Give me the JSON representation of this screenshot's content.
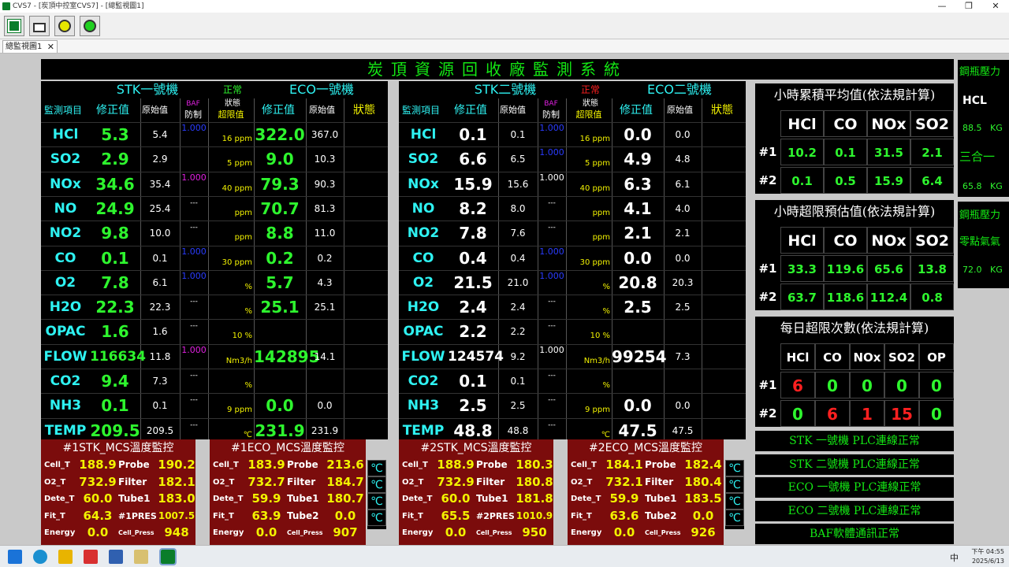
{
  "window": {
    "title": "CVS7 - [炭頂中控室CVS7] - [總監視圖1]",
    "min": "—",
    "max": "❐",
    "close": "✕"
  },
  "tab": {
    "label": "總監視圖1",
    "close": "✕"
  },
  "banner": "炭頂資源回收廠監測系統",
  "left": {
    "stk_title": "STK一號機",
    "stk_state": "正常",
    "eco_title": "ECO一號機",
    "headers": {
      "item": "監測項目",
      "corr": "修正值",
      "raw": "原始值",
      "baf_top": "BAF",
      "baf_bot": "防制",
      "state_top": "狀態",
      "state_bot": "超限值",
      "eco_corr": "修正值",
      "eco_raw": "原始值",
      "eco_state": "狀態"
    },
    "rows": [
      {
        "name": "HCl",
        "v": "5.3",
        "raw": "5.4",
        "baf": "1.000",
        "lim": "16 ppm",
        "ev": "322.0",
        "er": "367.0"
      },
      {
        "name": "SO2",
        "v": "2.9",
        "raw": "2.9",
        "baf": "",
        "lim": "5 ppm",
        "ev": "9.0",
        "er": "10.3"
      },
      {
        "name": "NOx",
        "v": "34.6",
        "raw": "35.4",
        "baf": "1.000",
        "lim": "40 ppm",
        "ev": "79.3",
        "er": "90.3"
      },
      {
        "name": "NO",
        "v": "24.9",
        "raw": "25.4",
        "baf": "---",
        "lim": "ppm",
        "ev": "70.7",
        "er": "81.3"
      },
      {
        "name": "NO2",
        "v": "9.8",
        "raw": "10.0",
        "baf": "---",
        "lim": "ppm",
        "ev": "8.8",
        "er": "11.0"
      },
      {
        "name": "CO",
        "v": "0.1",
        "raw": "0.1",
        "baf": "1.000",
        "lim": "30 ppm",
        "ev": "0.2",
        "er": "0.2"
      },
      {
        "name": "O2",
        "v": "7.8",
        "raw": "6.1",
        "baf": "1.000",
        "lim": "%",
        "ev": "5.7",
        "er": "4.3"
      },
      {
        "name": "H2O",
        "v": "22.3",
        "raw": "22.3",
        "baf": "---",
        "lim": "%",
        "ev": "25.1",
        "er": "25.1"
      },
      {
        "name": "OPAC",
        "v": "1.6",
        "raw": "1.6",
        "baf": "---",
        "lim": "10 %",
        "ev": "",
        "er": ""
      },
      {
        "name": "FLOW",
        "v": "116634",
        "raw": "11.8",
        "baf": "1.000",
        "lim": "Nm3/h",
        "ev": "142895",
        "er": "14.1"
      },
      {
        "name": "CO2",
        "v": "9.4",
        "raw": "7.3",
        "baf": "---",
        "lim": "%",
        "ev": "",
        "er": ""
      },
      {
        "name": "NH3",
        "v": "0.1",
        "raw": "0.1",
        "baf": "---",
        "lim": "9 ppm",
        "ev": "0.0",
        "er": "0.0"
      },
      {
        "name": "TEMP",
        "v": "209.5",
        "raw": "209.5",
        "baf": "---",
        "lim": "℃",
        "ev": "231.9",
        "er": "231.9"
      }
    ]
  },
  "right": {
    "stk_title": "STK二號機",
    "stk_state": "正常",
    "eco_title": "ECO二號機",
    "headers": {
      "item": "監測項目",
      "corr": "修正值",
      "raw": "原始值",
      "baf_top": "BAF",
      "baf_bot": "防制",
      "state_top": "狀態",
      "state_bot": "超限值",
      "eco_corr": "修正值",
      "eco_raw": "原始值",
      "eco_state": "狀態"
    },
    "rows": [
      {
        "name": "HCl",
        "v": "0.1",
        "raw": "0.1",
        "baf": "1.000",
        "lim": "16 ppm",
        "ev": "0.0",
        "er": "0.0"
      },
      {
        "name": "SO2",
        "v": "6.6",
        "raw": "6.5",
        "baf": "1.000",
        "lim": "5 ppm",
        "ev": "4.9",
        "er": "4.8"
      },
      {
        "name": "NOx",
        "v": "15.9",
        "raw": "15.6",
        "baf": "1.000",
        "lim": "40 ppm",
        "ev": "6.3",
        "er": "6.1"
      },
      {
        "name": "NO",
        "v": "8.2",
        "raw": "8.0",
        "baf": "---",
        "lim": "ppm",
        "ev": "4.1",
        "er": "4.0"
      },
      {
        "name": "NO2",
        "v": "7.8",
        "raw": "7.6",
        "baf": "---",
        "lim": "ppm",
        "ev": "2.1",
        "er": "2.1"
      },
      {
        "name": "CO",
        "v": "0.4",
        "raw": "0.4",
        "baf": "1.000",
        "lim": "30 ppm",
        "ev": "0.0",
        "er": "0.0"
      },
      {
        "name": "O2",
        "v": "21.5",
        "raw": "21.0",
        "baf": "1.000",
        "lim": "%",
        "ev": "20.8",
        "er": "20.3"
      },
      {
        "name": "H2O",
        "v": "2.4",
        "raw": "2.4",
        "baf": "---",
        "lim": "%",
        "ev": "2.5",
        "er": "2.5"
      },
      {
        "name": "OPAC",
        "v": "2.2",
        "raw": "2.2",
        "baf": "---",
        "lim": "10 %",
        "ev": "",
        "er": ""
      },
      {
        "name": "FLOW",
        "v": "124574",
        "raw": "9.2",
        "baf": "1.000",
        "lim": "Nm3/h",
        "ev": "99254",
        "er": "7.3"
      },
      {
        "name": "CO2",
        "v": "0.1",
        "raw": "0.1",
        "baf": "---",
        "lim": "%",
        "ev": "",
        "er": ""
      },
      {
        "name": "NH3",
        "v": "2.5",
        "raw": "2.5",
        "baf": "---",
        "lim": "9 ppm",
        "ev": "0.0",
        "er": "0.0"
      },
      {
        "name": "TEMP",
        "v": "48.8",
        "raw": "48.8",
        "baf": "---",
        "lim": "℃",
        "ev": "47.5",
        "er": "47.5"
      }
    ]
  },
  "mcs": [
    {
      "title": "#1STK_MCS溫度監控",
      "l": [
        "Cell_T",
        "O2_T",
        "Dete_T",
        "Fit_T",
        "Energy"
      ],
      "lv": [
        "188.9",
        "732.9",
        "60.0",
        "64.3",
        "0.0"
      ],
      "r": [
        "Probe",
        "Filter",
        "Tube1",
        "#1PRES",
        "Cell_Press"
      ],
      "rv": [
        "190.2",
        "182.1",
        "183.0",
        "1007.5",
        "948"
      ]
    },
    {
      "title": "#1ECO_MCS溫度監控",
      "l": [
        "Cell_T",
        "O2_T",
        "Dete_T",
        "Fit_T",
        "Energy"
      ],
      "lv": [
        "183.9",
        "732.7",
        "59.9",
        "63.9",
        "0.0"
      ],
      "r": [
        "Probe",
        "Filter",
        "Tube1",
        "Tube2",
        "Cell_Press"
      ],
      "rv": [
        "213.6",
        "184.7",
        "180.7",
        "0.0",
        "907"
      ]
    },
    {
      "title": "#2STK_MCS溫度監控",
      "l": [
        "Cell_T",
        "O2_T",
        "Dete_T",
        "Fit_T",
        "Energy"
      ],
      "lv": [
        "188.9",
        "732.9",
        "60.0",
        "65.5",
        "0.0"
      ],
      "r": [
        "Probe",
        "Filter",
        "Tube1",
        "#2PRES",
        "Cell_Press"
      ],
      "rv": [
        "180.3",
        "180.8",
        "181.8",
        "1010.9",
        "950"
      ]
    },
    {
      "title": "#2ECO_MCS溫度監控",
      "l": [
        "Cell_T",
        "O2_T",
        "Dete_T",
        "Fit_T",
        "Energy"
      ],
      "lv": [
        "184.1",
        "732.1",
        "59.9",
        "63.6",
        "0.0"
      ],
      "r": [
        "Probe",
        "Filter",
        "Tube1",
        "Tube2",
        "Cell_Press"
      ],
      "rv": [
        "182.4",
        "180.4",
        "183.5",
        "0.0",
        "926"
      ]
    }
  ],
  "deg": "℃",
  "hourly_avg": {
    "title": "小時累積平均值(依法規計算)",
    "cols": [
      "HCl",
      "CO",
      "NOx",
      "SO2"
    ],
    "rows": [
      {
        "id": "#1",
        "vals": [
          "10.2",
          "0.1",
          "31.5",
          "2.1"
        ]
      },
      {
        "id": "#2",
        "vals": [
          "0.1",
          "0.5",
          "15.9",
          "6.4"
        ]
      }
    ]
  },
  "hourly_est": {
    "title": "小時超限預估值(依法規計算)",
    "cols": [
      "HCl",
      "CO",
      "NOx",
      "SO2"
    ],
    "rows": [
      {
        "id": "#1",
        "vals": [
          "33.3",
          "119.6",
          "65.6",
          "13.8"
        ]
      },
      {
        "id": "#2",
        "vals": [
          "63.7",
          "118.6",
          "112.4",
          "0.8"
        ]
      }
    ]
  },
  "daily": {
    "title": "每日超限次數(依法規計算)",
    "cols": [
      "HCl",
      "CO",
      "NOx",
      "SO2",
      "OP"
    ],
    "rows": [
      {
        "id": "#1",
        "vals": [
          "6",
          "0",
          "0",
          "0",
          "0"
        ]
      },
      {
        "id": "#2",
        "vals": [
          "0",
          "6",
          "1",
          "15",
          "0"
        ]
      }
    ]
  },
  "status": [
    "STK 一號機 PLC連線正常",
    "STK 二號機 PLC連線正常",
    "ECO 一號機 PLC連線正常",
    "ECO 二號機 PLC連線正常",
    "BAF軟體通訊正常"
  ],
  "far": {
    "p1": "鋼瓶壓力",
    "hcl": "HCL",
    "v1": "88.5",
    "kg": "KG",
    "mix": "三合一",
    "v2": "65.8",
    "p2": "鋼瓶壓力",
    "zero": "零點氣氣",
    "v3": "72.0"
  },
  "clock": {
    "time": "下午 04:55",
    "date": "2025/6/13",
    "ime": "中"
  }
}
